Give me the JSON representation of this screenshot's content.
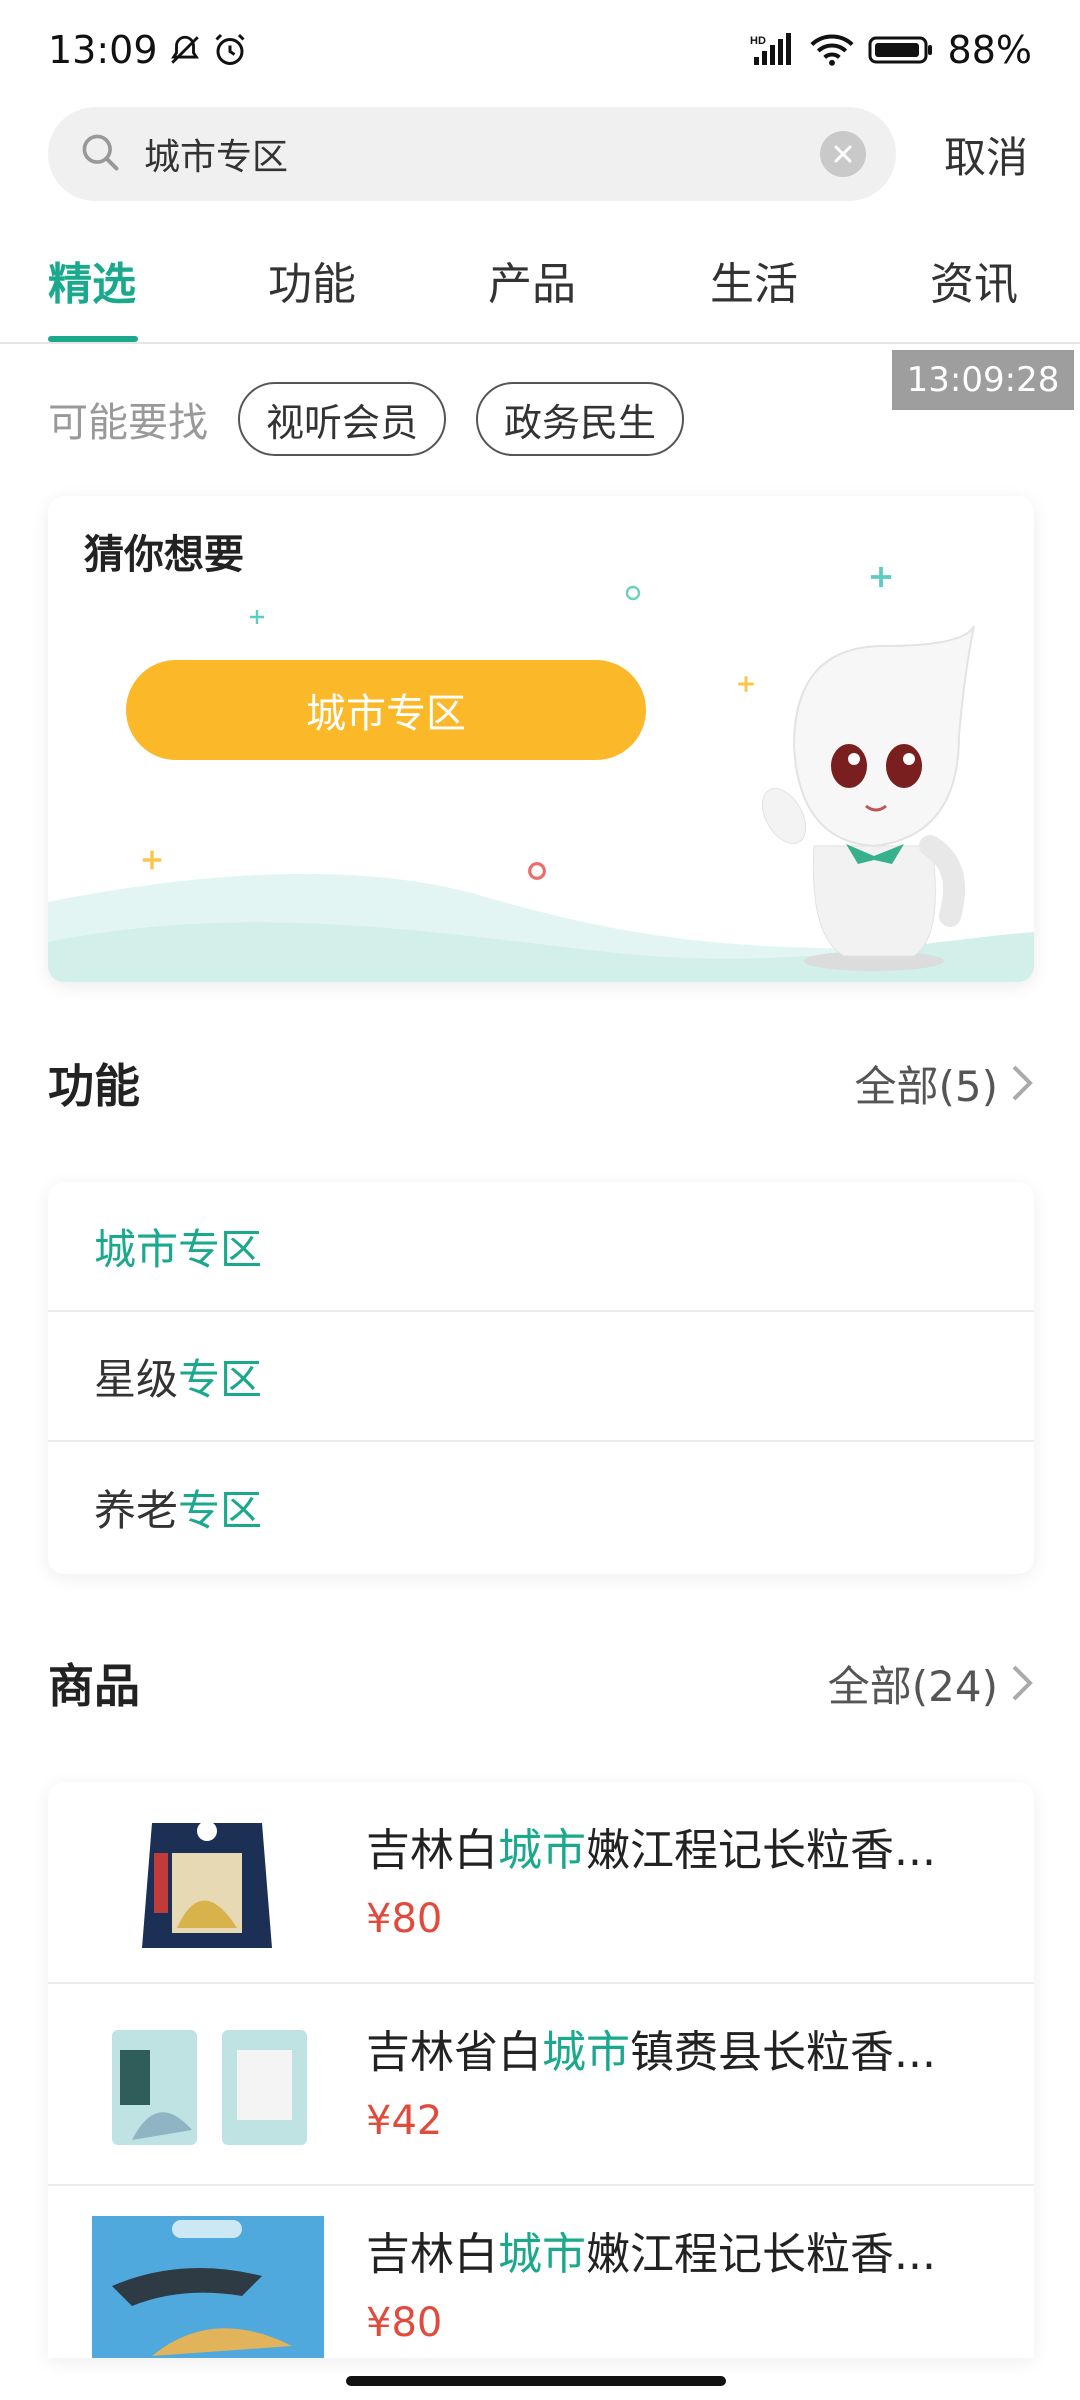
{
  "status_bar": {
    "time": "13:09",
    "battery": "88%",
    "network_label": "HD"
  },
  "search": {
    "query": "城市专区",
    "cancel_label": "取消"
  },
  "tabs": [
    {
      "label": "精选",
      "active": true
    },
    {
      "label": "功能",
      "active": false
    },
    {
      "label": "产品",
      "active": false
    },
    {
      "label": "生活",
      "active": false
    },
    {
      "label": "资讯",
      "active": false
    }
  ],
  "timestamp_overlay": "13:09:28",
  "suggestions": {
    "label": "可能要找",
    "chips": [
      "视听会员",
      "政务民生"
    ]
  },
  "guess": {
    "title": "猜你想要",
    "button_label": "城市专区"
  },
  "functions": {
    "title": "功能",
    "more_label": "全部(5)",
    "items": [
      {
        "prefix": "",
        "highlight": "城市专区"
      },
      {
        "prefix": "星级",
        "highlight": "专区"
      },
      {
        "prefix": "养老",
        "highlight": "专区"
      }
    ]
  },
  "products": {
    "title": "商品",
    "more_label": "全部(24)",
    "items": [
      {
        "pre": "吉林白",
        "hl": "城市",
        "post": "嫩江程记长粒香...",
        "price": "¥80"
      },
      {
        "pre": "吉林省白",
        "hl": "城市",
        "post": "镇赉县长粒香...",
        "price": "¥42"
      },
      {
        "pre": "吉林白",
        "hl": "城市",
        "post": "嫩江程记长粒香...",
        "price": "¥80"
      }
    ]
  },
  "colors": {
    "accent": "#1aa98c",
    "button": "#fbb829",
    "price": "#e04b3c"
  }
}
